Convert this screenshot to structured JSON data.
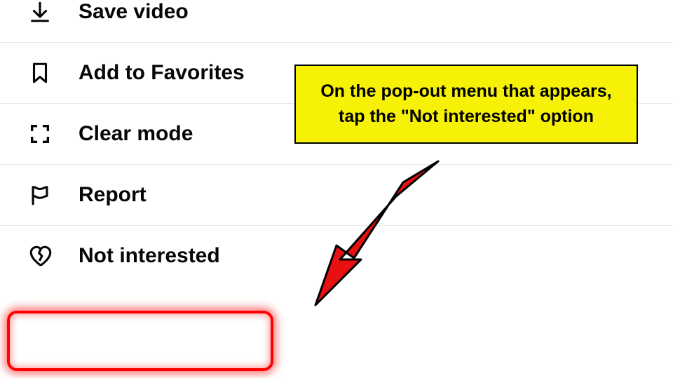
{
  "menu": {
    "items": [
      {
        "icon": "download-icon",
        "label": "Save video"
      },
      {
        "icon": "bookmark-icon",
        "label": "Add to Favorites"
      },
      {
        "icon": "fullscreen-icon",
        "label": "Clear mode"
      },
      {
        "icon": "flag-icon",
        "label": "Report"
      },
      {
        "icon": "heart-broken-icon",
        "label": "Not interested"
      }
    ]
  },
  "callout": {
    "text": "On the pop-out menu that appears, tap the \"Not interested\" option"
  },
  "highlight": {
    "target_index": 4,
    "color": "#ff0000"
  }
}
